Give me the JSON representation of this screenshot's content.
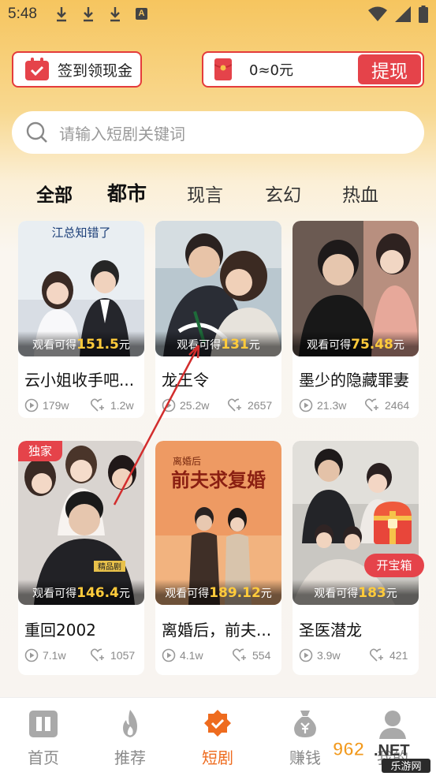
{
  "status_bar": {
    "time": "5:48",
    "a_label": "A"
  },
  "top": {
    "checkin_label": "签到领现金",
    "balance": "0≈0元",
    "withdraw_label": "提现"
  },
  "search": {
    "placeholder": "请输入短剧关键词"
  },
  "categories": [
    "全部",
    "都市",
    "现言",
    "玄幻",
    "热血"
  ],
  "earn_prefix": "观看可得",
  "earn_suffix": "元",
  "dramas": [
    {
      "title": "云小姐收手吧...",
      "earn": "151.5",
      "views": "179w",
      "likes": "1.2w",
      "poster_text": "江总知错了"
    },
    {
      "title": "龙王令",
      "earn": "131",
      "views": "25.2w",
      "likes": "2657"
    },
    {
      "title": "墨少的隐藏罪妻",
      "earn": "75.48",
      "views": "21.3w",
      "likes": "2464"
    },
    {
      "title": "重回2002",
      "earn": "146.4",
      "views": "7.1w",
      "likes": "1057",
      "badge": "独家",
      "poster_tag": "精品剧"
    },
    {
      "title": "离婚后，前夫...",
      "earn": "189.12",
      "views": "4.1w",
      "likes": "554",
      "poster_text": "前夫求复婚",
      "poster_sub": "离婚后"
    },
    {
      "title": "圣医潜龙",
      "earn": "183",
      "views": "3.9w",
      "likes": "421"
    }
  ],
  "treasure_label": "开宝箱",
  "nav": [
    {
      "label": "首页",
      "icon": "book-icon"
    },
    {
      "label": "推荐",
      "icon": "flame-icon"
    },
    {
      "label": "短剧",
      "icon": "shortdrama-badge-icon",
      "active": true
    },
    {
      "label": "赚钱",
      "icon": "money-bag-icon"
    },
    {
      "label": "我的",
      "icon": "user-icon"
    }
  ],
  "watermark": {
    "text": "962.NET",
    "sub": "乐游网"
  },
  "colors": {
    "accent": "#e5434a",
    "active_nav": "#ee6b1e",
    "earn_number": "#ffcb3b"
  }
}
